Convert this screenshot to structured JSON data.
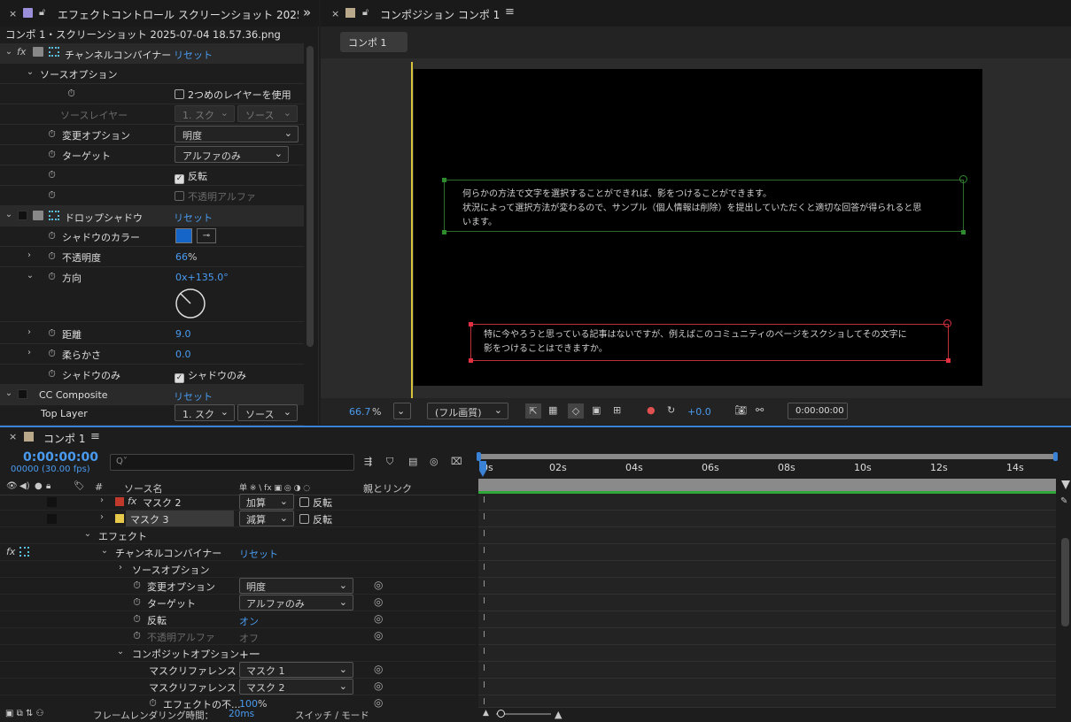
{
  "effect_panel": {
    "tab_title": "エフェクトコントロール スクリーンショット 2025-",
    "expand_icon": "»",
    "layer_title": "コンポ 1・スクリーンショット 2025-07-04 18.57.36.png",
    "channel_combiner": {
      "fx": "fx",
      "name": "チャンネルコンバイナー",
      "reset": "リセット",
      "source_options": "ソースオプション",
      "use_second_layer": "2つめのレイヤーを使用",
      "source_layer_label": "ソースレイヤー",
      "source_layer_value": "1. スク",
      "source_value": "ソース",
      "change_option_label": "変更オプション",
      "change_option_value": "明度",
      "target_label": "ターゲット",
      "target_value": "アルファのみ",
      "invert_label": "反転",
      "unpremult_label": "不透明アルファ"
    },
    "drop_shadow": {
      "name": "ドロップシャドウ",
      "reset": "リセット",
      "color_label": "シャドウのカラー",
      "color_value": "#1565c8",
      "opacity_label": "不透明度",
      "opacity_value": "66",
      "opacity_unit": "%",
      "direction_label": "方向",
      "direction_value": "0x+135.0°",
      "distance_label": "距離",
      "distance_value": "9.0",
      "softness_label": "柔らかさ",
      "softness_value": "0.0",
      "shadow_only_label": "シャドウのみ",
      "shadow_only_checkbox": "シャドウのみ"
    },
    "cc_composite": {
      "name": "CC Composite",
      "reset": "リセット",
      "top_layer_label": "Top Layer",
      "top_layer_value": "1. スク",
      "source_value": "ソース"
    }
  },
  "composition_panel": {
    "tab_title": "コンポジション コンポ 1",
    "comp_tab": "コンポ 1",
    "text_box_1": [
      "何らかの方法で文字を選択することができれば、影をつけることができます。",
      "状況によって選択方法が変わるので、サンプル（個人情報は削除）を提出していただくと適切な回答が得られると思",
      "います。"
    ],
    "text_box_2": [
      "特に今やろうと思っている記事はないですが、例えばこのコミュニティのページをスクショしてその文字に",
      "影をつけることはできますか。"
    ],
    "zoom": "66.7",
    "zoom_unit": "%",
    "resolution": "(フル画質)",
    "exposure": "+0.0",
    "timecode": "0:00:00:00"
  },
  "timeline": {
    "tab_title": "コンポ 1",
    "current_time": "0:00:00:00",
    "frame_info": "00000 (30.00 fps)",
    "search_placeholder": "Q˅",
    "col_source_name": "ソース名",
    "col_switches": "单 ※ \\ fx ▣ ◎ ◑ ◌",
    "col_parent": "親とリンク",
    "ruler": [
      "0s",
      "02s",
      "04s",
      "06s",
      "08s",
      "10s",
      "12s",
      "14s"
    ],
    "layers": [
      {
        "name": "マスク 2",
        "color": "#c0392b",
        "mode": "加算",
        "invert": "反転"
      },
      {
        "name": "マスク 3",
        "color": "#e6c84a",
        "mode": "減算",
        "invert": "反転"
      }
    ],
    "effects_label": "エフェクト",
    "channel_combiner": {
      "name": "チャンネルコンバイナー",
      "reset": "リセット",
      "source_options": "ソースオプション",
      "change_option_label": "変更オプション",
      "change_option_value": "明度",
      "target_label": "ターゲット",
      "target_value": "アルファのみ",
      "invert_label": "反転",
      "invert_value": "オン",
      "unpremult_label": "不透明アルファ",
      "unpremult_value": "オフ",
      "composite_options": "コンポジットオプション",
      "plus_minus": "+ー",
      "mask_ref1_label": "マスクリファレンス 1",
      "mask_ref1_value": "マスク 1",
      "mask_ref2_label": "マスクリファレンス 2",
      "mask_ref2_value": "マスク 2",
      "effect_opacity_label": "エフェクトの不...",
      "effect_opacity_value": "100",
      "effect_opacity_unit": "%"
    },
    "footer_render_label": "フレームレンダリング時間：",
    "footer_render_value": "20ms",
    "footer_switch_mode": "スイッチ / モード"
  }
}
